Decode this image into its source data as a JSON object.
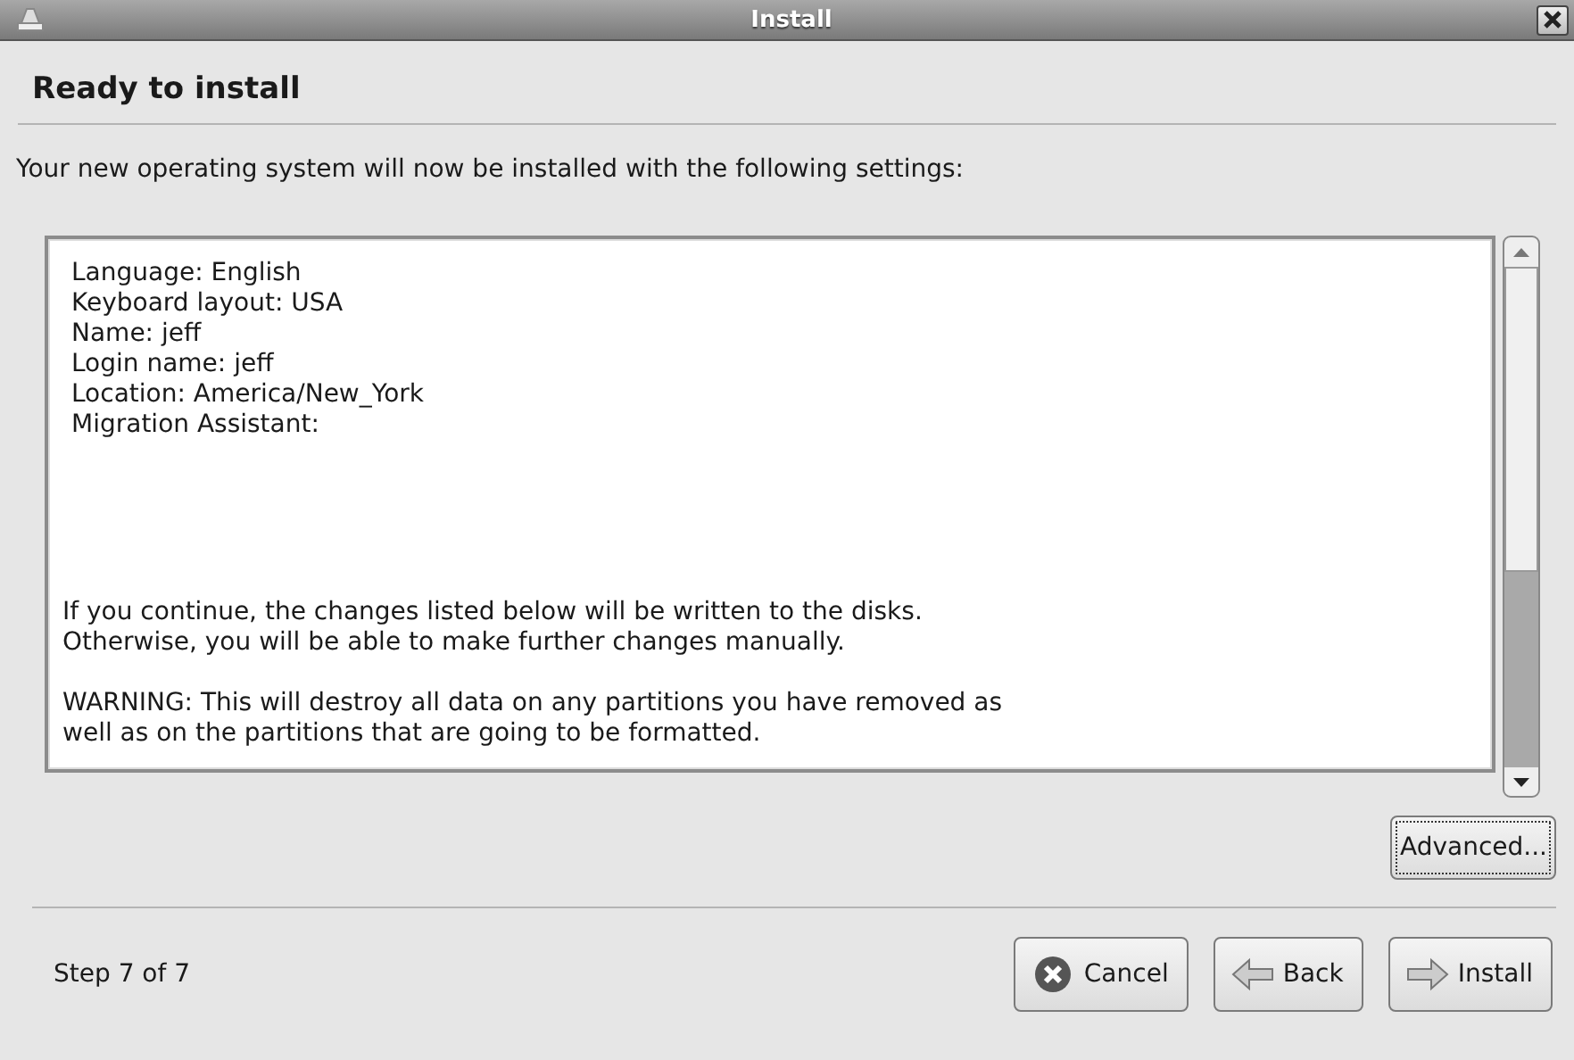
{
  "window": {
    "title": "Install"
  },
  "heading": "Ready to install",
  "intro": "Your new operating system will now be installed with the following settings:",
  "summary": {
    "settings": [
      "Language: English",
      "Keyboard layout: USA",
      "Name: jeff",
      "Login name: jeff",
      "Location: America/New_York",
      "Migration Assistant:"
    ],
    "paragraphs": [
      [
        "If you continue, the changes listed below will be written to the disks.",
        "Otherwise, you will be able to make further changes manually."
      ],
      [
        "WARNING: This will destroy all data on any partitions you have removed as",
        "well as on the partitions that are going to be formatted."
      ]
    ]
  },
  "advanced_button": "Advanced...",
  "step": "Step 7 of 7",
  "buttons": [
    {
      "kind": "cancel",
      "label": "Cancel"
    },
    {
      "kind": "back",
      "label": "Back"
    },
    {
      "kind": "forward",
      "label": "Install"
    }
  ]
}
